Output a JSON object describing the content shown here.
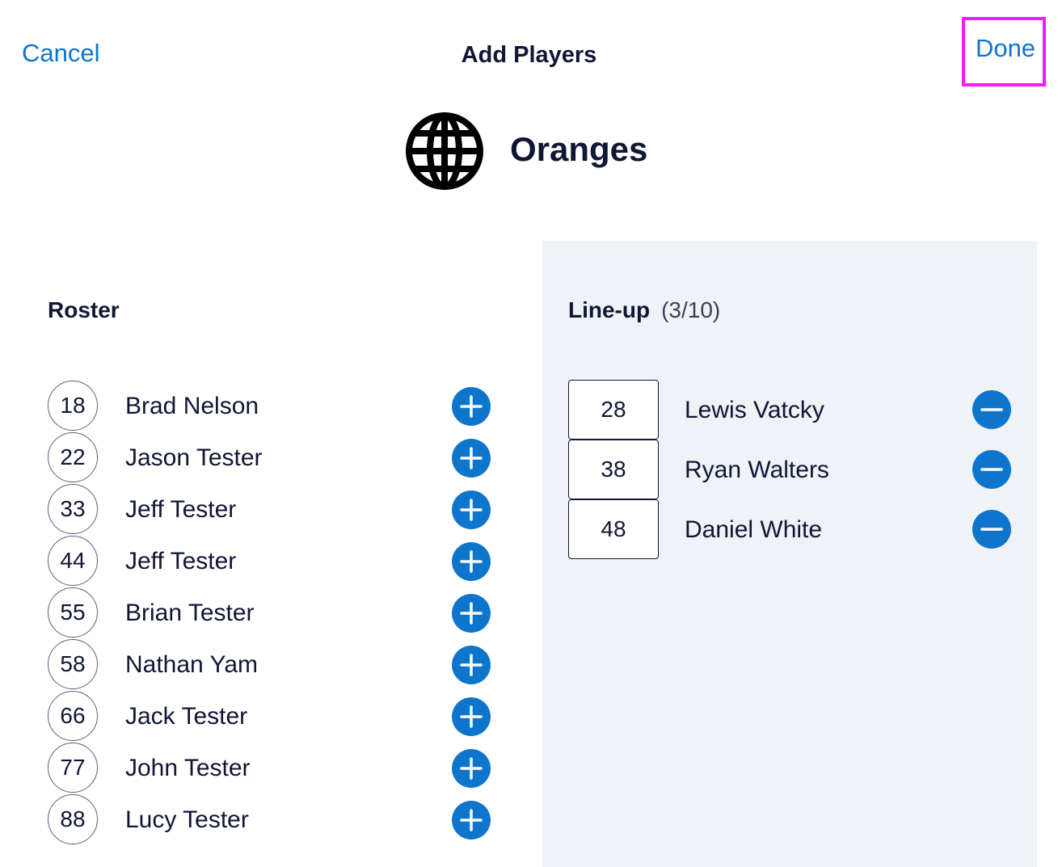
{
  "header": {
    "cancel_label": "Cancel",
    "title": "Add Players",
    "done_label": "Done"
  },
  "team": {
    "name": "Oranges",
    "icon": "globe-icon"
  },
  "roster": {
    "title": "Roster",
    "add_icon": "plus-circle-icon",
    "players": [
      {
        "number": "18",
        "name": "Brad Nelson"
      },
      {
        "number": "22",
        "name": "Jason Tester"
      },
      {
        "number": "33",
        "name": "Jeff Tester"
      },
      {
        "number": "44",
        "name": "Jeff Tester"
      },
      {
        "number": "55",
        "name": "Brian Tester"
      },
      {
        "number": "58",
        "name": "Nathan Yam"
      },
      {
        "number": "66",
        "name": "Jack Tester"
      },
      {
        "number": "77",
        "name": "John Tester"
      },
      {
        "number": "88",
        "name": "Lucy Tester"
      }
    ]
  },
  "lineup": {
    "title": "Line-up",
    "count": "(3/10)",
    "remove_icon": "minus-circle-icon",
    "players": [
      {
        "number": "28",
        "name": "Lewis Vatcky"
      },
      {
        "number": "38",
        "name": "Ryan Walters"
      },
      {
        "number": "48",
        "name": "Daniel White"
      }
    ]
  },
  "colors": {
    "accent": "#0e75cc",
    "text": "#101634",
    "panel_bg": "#eff2f7",
    "highlight": "#f01cf0"
  }
}
